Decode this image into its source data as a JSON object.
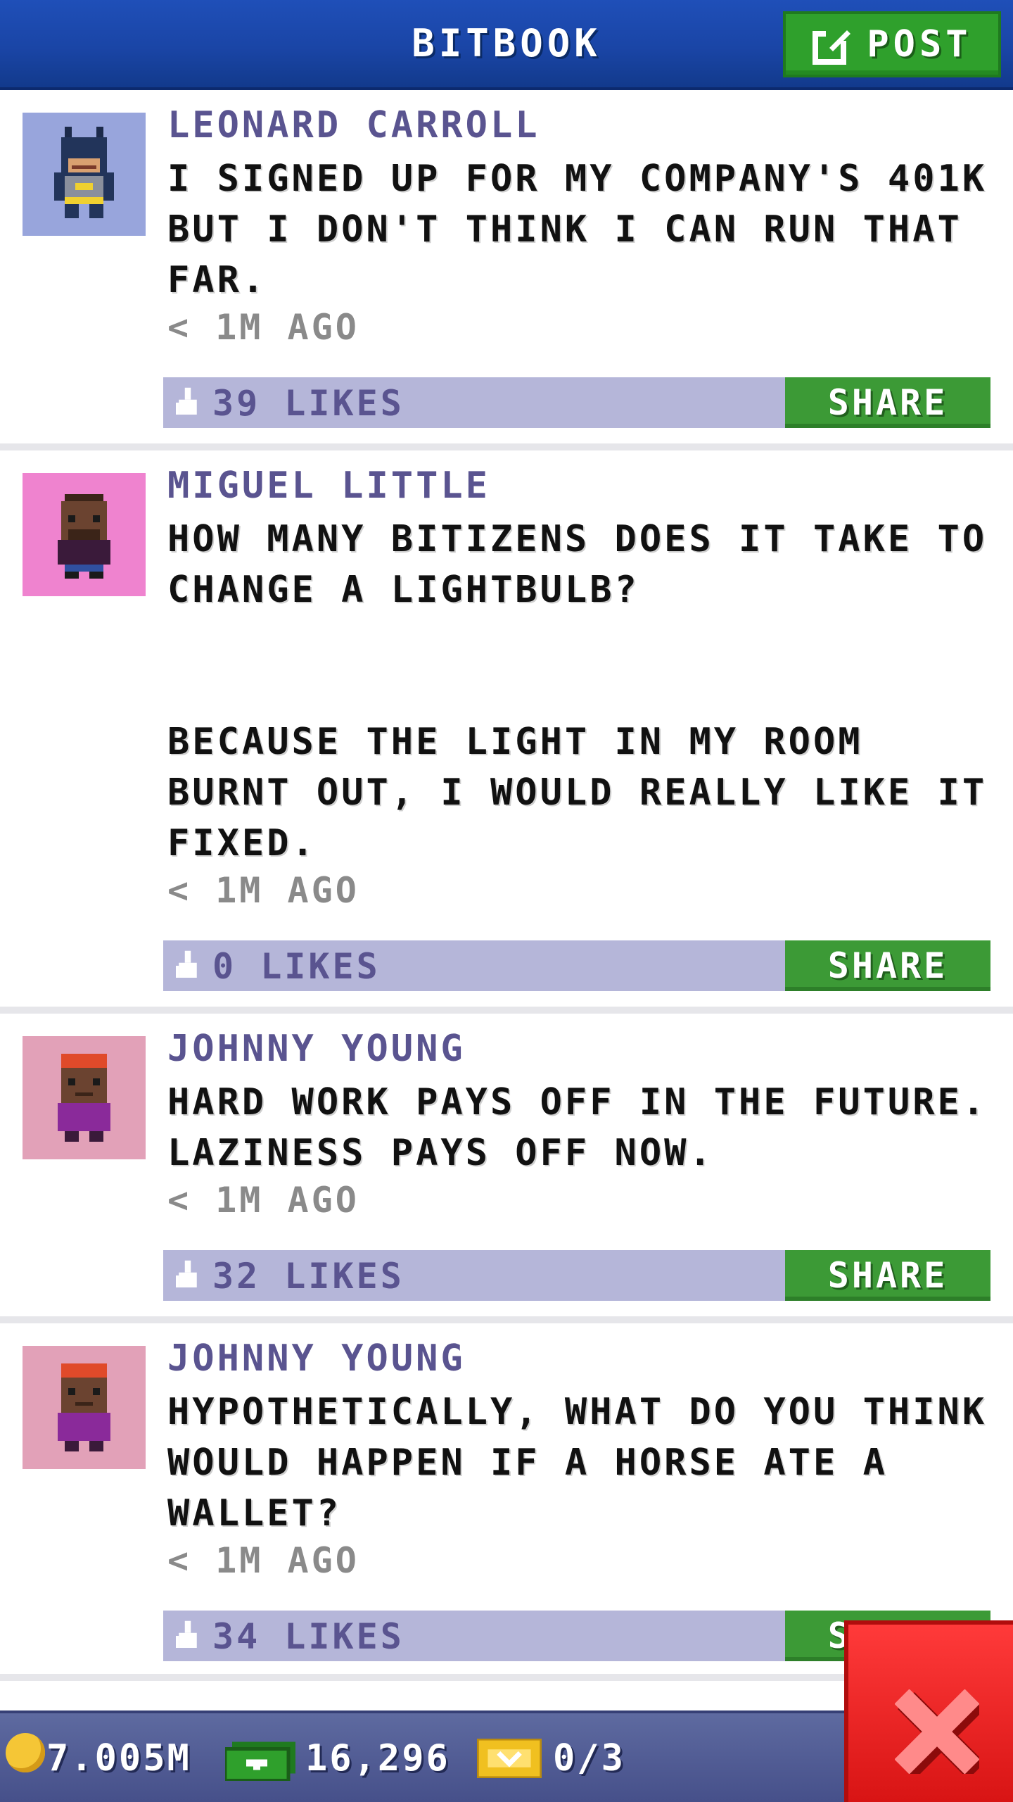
{
  "header": {
    "title": "BITBOOK",
    "post_label": "POST"
  },
  "posts": [
    {
      "author": "LEONARD CARROLL",
      "text": "I SIGNED UP FOR MY COMPANY'S 401K\nBUT I DON'T THINK I CAN RUN THAT\nFAR.",
      "time": "< 1M AGO",
      "likes": "39 LIKES",
      "share": "SHARE",
      "avatar_bg": "#98a5dc"
    },
    {
      "author": "MIGUEL LITTLE",
      "text": "HOW MANY BITIZENS DOES IT TAKE TO\nCHANGE A LIGHTBULB?\n\n\nBECAUSE THE LIGHT IN MY ROOM\nBURNT OUT, I WOULD REALLY LIKE IT\nFIXED.",
      "time": "< 1M AGO",
      "likes": "0 LIKES",
      "share": "SHARE",
      "avatar_bg": "#ef83cf"
    },
    {
      "author": "JOHNNY YOUNG",
      "text": "HARD WORK PAYS OFF IN THE FUTURE.\nLAZINESS PAYS OFF NOW.",
      "time": "< 1M AGO",
      "likes": "32 LIKES",
      "share": "SHARE",
      "avatar_bg": "#e2a1b8"
    },
    {
      "author": "JOHNNY YOUNG",
      "text": "HYPOTHETICALLY, WHAT DO YOU THINK\nWOULD HAPPEN IF A HORSE ATE A\nWALLET?",
      "time": "< 1M AGO",
      "likes": "34 LIKES",
      "share": "SHARE",
      "avatar_bg": "#e2a1b8"
    }
  ],
  "bottom_bar": {
    "coins": "7.005M",
    "bux": "16,296",
    "tickets": "0/3"
  },
  "icons": {
    "post": "edit-icon",
    "like": "thumbs-up-icon",
    "coin": "coin-icon",
    "bux": "bux-icon",
    "ticket": "ticket-icon",
    "close": "close-icon"
  }
}
